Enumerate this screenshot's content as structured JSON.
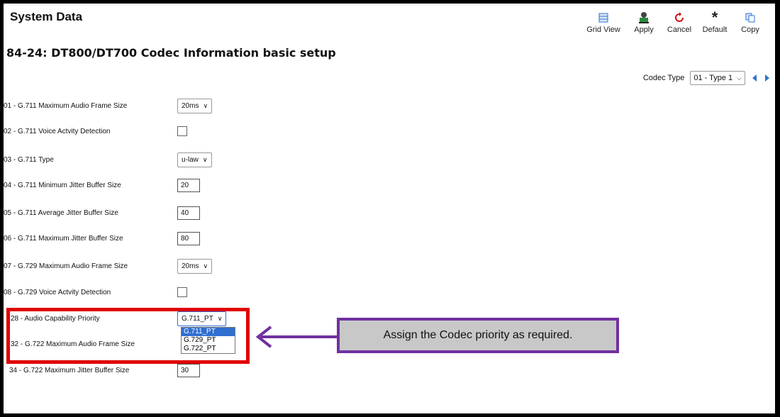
{
  "header": {
    "title": "System Data"
  },
  "toolbar": {
    "grid_view": "Grid View",
    "apply": "Apply",
    "cancel": "Cancel",
    "default": "Default",
    "copy": "Copy"
  },
  "subtitle": "84-24: DT800/DT700 Codec Information basic setup",
  "codec_type": {
    "label": "Codec Type",
    "value": "01 - Type 1"
  },
  "rows": [
    {
      "label": "01 - G.711 Maximum Audio Frame Size",
      "value": "20ms"
    },
    {
      "label": "02 - G.711 Voice Actvity Detection",
      "checked": false
    },
    {
      "label": "03 - G.711 Type",
      "value": "u-law"
    },
    {
      "label": "04 - G.711 Minimum Jitter Buffer Size",
      "value": "20"
    },
    {
      "label": "05 - G.711 Average Jitter Buffer Size",
      "value": "40"
    },
    {
      "label": "06 - G.711 Maximum Jitter Buffer Size",
      "value": "80"
    },
    {
      "label": "07 - G.729 Maximum Audio Frame Size",
      "value": "20ms"
    },
    {
      "label": "08 - G.729 Voice Actvity Detection",
      "checked": false
    },
    {
      "label": "28 - Audio Capability Priority",
      "value": "G.711_PT"
    },
    {
      "label": "32 - G.722 Maximum Audio Frame Size"
    },
    {
      "label": "34 - G.722 Maximum Jitter Buffer Size",
      "value": "30"
    }
  ],
  "priority_options": [
    "G.711_PT",
    "G.729_PT",
    "G.722_PT"
  ],
  "callout": {
    "text": "Assign the Codec priority as required."
  },
  "colors": {
    "highlight": "#e00000",
    "callout_border": "#7030a0",
    "callout_bg": "#c8c8c8",
    "accent": "#2f6fd0"
  }
}
